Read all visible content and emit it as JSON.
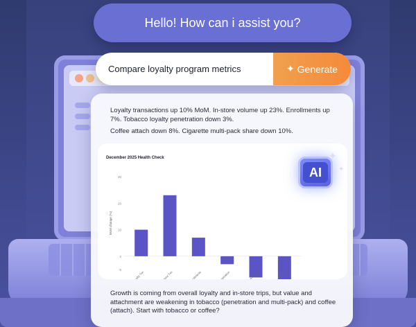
{
  "greeting": "Hello! How can i assist you?",
  "prompt": {
    "query": "Compare loyalty program metrics",
    "generate_label": "Generate",
    "generate_icon": "sparkles-icon"
  },
  "summary": {
    "line1": "Loyalty transactions up 10% MoM. In-store volume up 23%. Enrollments up 7%. Tobacco loyalty penetration down 3%.",
    "line2": "Coffee attach down 8%. Cigarette multi-pack share down 10%."
  },
  "badge": {
    "label": "AI"
  },
  "chart_data": {
    "type": "bar",
    "title": "December 2025 Health Check",
    "ylabel": "MoM change (%)",
    "ylim": [
      -5,
      30
    ],
    "yticks": [
      "30",
      "20",
      "10",
      "0",
      "-5"
    ],
    "categories": [
      "Loyalty Txn",
      "In-store Txn",
      "Enrollments",
      "Tobacco Loyalty Penetration",
      "Coffee Attach",
      "Cig Multi-pack Share"
    ],
    "values": [
      10,
      23,
      7,
      -3,
      -8,
      -10
    ],
    "color": "#5b54c6"
  },
  "footer": "Growth is coming from overall loyalty and in-store trips, but value and attachment are weakening in tobacco (penetration and multi-pack) and coffee (attach). Start with tobacco or coffee?"
}
